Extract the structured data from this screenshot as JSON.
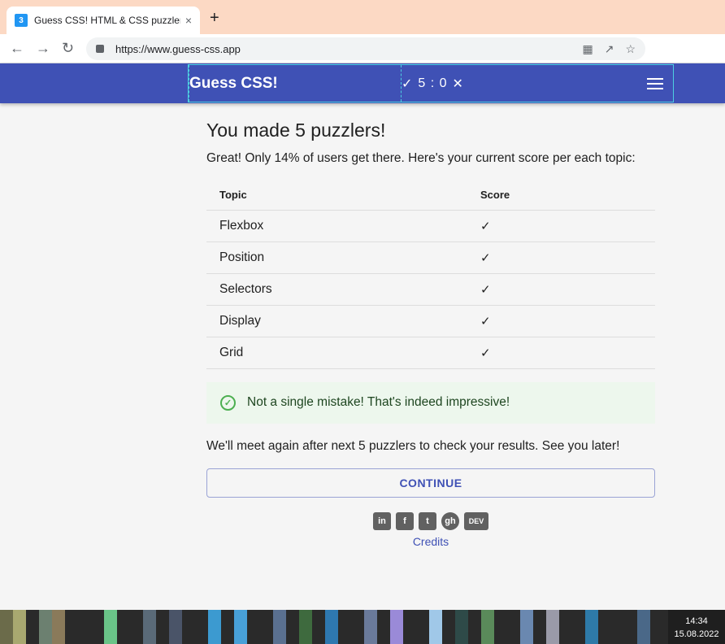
{
  "browser": {
    "tab_title": "Guess CSS! HTML & CSS puzzler",
    "tab_close": "×",
    "new_tab": "+",
    "url": "https://www.guess-css.app"
  },
  "app": {
    "title": "Guess CSS!",
    "score_check": "✓",
    "score_text": "5 : 0",
    "score_cross": "✕"
  },
  "main": {
    "heading": "You made 5 puzzlers!",
    "subtitle": "Great! Only 14% of users get there. Here's your current score per each topic:",
    "table": {
      "headers": [
        "Topic",
        "Score"
      ],
      "rows": [
        {
          "topic": "Flexbox",
          "score": "✓"
        },
        {
          "topic": "Position",
          "score": "✓"
        },
        {
          "topic": "Selectors",
          "score": "✓"
        },
        {
          "topic": "Display",
          "score": "✓"
        },
        {
          "topic": "Grid",
          "score": "✓"
        }
      ]
    },
    "alert": "Not a single mistake! That's indeed impressive!",
    "again_text": "We'll meet again after next 5 puzzlers to check your results. See you later!",
    "continue_label": "CONTINUE",
    "social": {
      "linkedin": "in",
      "facebook": "f",
      "twitter": "t",
      "github": "gh",
      "dev": "DEV"
    },
    "credits": "Credits"
  },
  "taskbar": {
    "time": "14:34",
    "date": "15.08.2022"
  },
  "colors": {
    "appbar": "#3f51b5",
    "accent": "#3f51b5",
    "success": "#4caf50",
    "alert_bg": "#edf7ed"
  }
}
